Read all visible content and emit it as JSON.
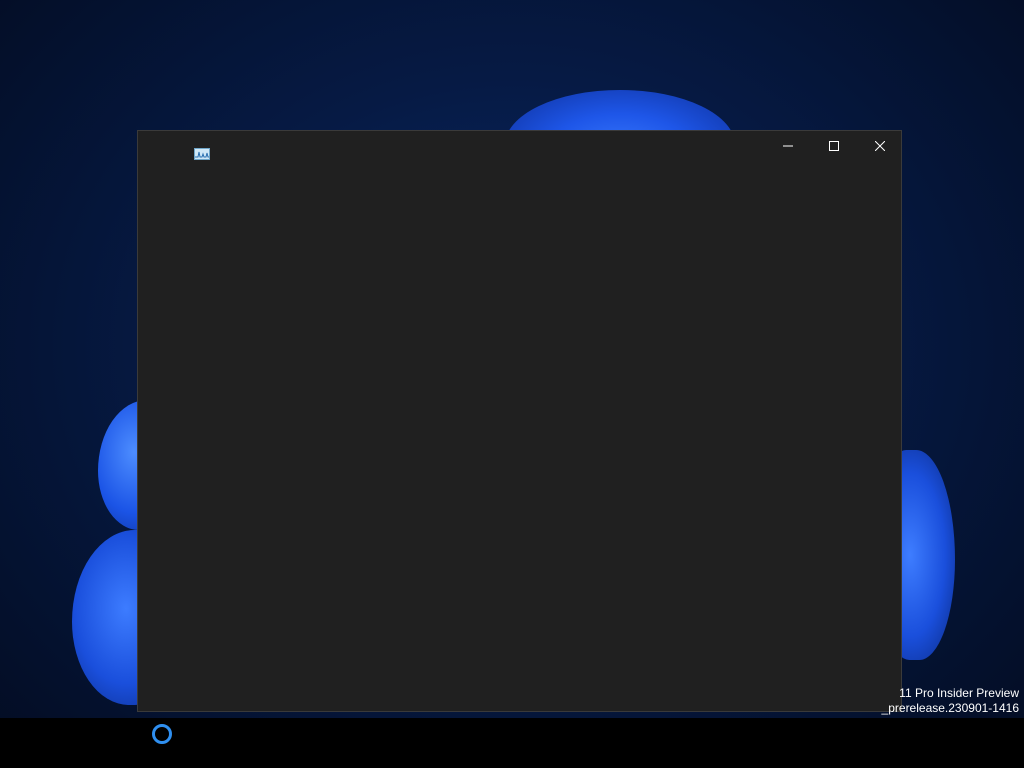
{
  "window": {
    "title_icon": "performance-chart-icon",
    "buttons": {
      "minimize_icon": "minimize-icon",
      "maximize_icon": "maximize-icon",
      "close_icon": "close-icon"
    },
    "background_color": "#202020"
  },
  "desktop": {
    "watermark_line1": "11 Pro Insider Preview",
    "watermark_line2": "_prerelease.230901-1416"
  },
  "taskbar": {
    "loading_indicator_icon": "loading-ring-icon",
    "accent_color": "#2f8ff0"
  }
}
